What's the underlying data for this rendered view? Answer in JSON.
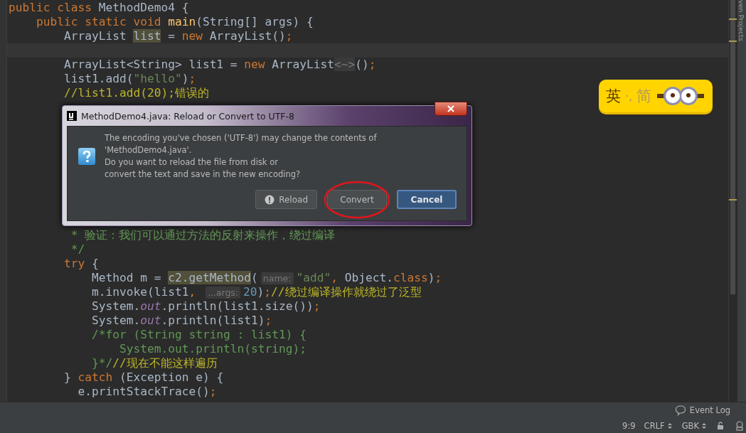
{
  "editor": {
    "lines_top": [
      {
        "current": false,
        "tokens": [
          {
            "kind": "keyword",
            "text": "public class "
          },
          {
            "kind": "plain",
            "text": "MethodDemo4 {"
          }
        ]
      },
      {
        "current": false,
        "tokens": [
          {
            "kind": "keyword",
            "text": "    public static void "
          },
          {
            "kind": "method",
            "text": "main"
          },
          {
            "kind": "plain",
            "text": "(String[] args) {"
          }
        ]
      },
      {
        "current": false,
        "tokens": [
          {
            "kind": "plain",
            "text": "        ArrayList "
          },
          {
            "kind": "usage",
            "text": "list"
          },
          {
            "kind": "plain",
            "text": " = "
          },
          {
            "kind": "keyword",
            "text": "new "
          },
          {
            "kind": "plain",
            "text": "ArrayList()"
          },
          {
            "kind": "keyword",
            "text": ";"
          }
        ]
      },
      {
        "current": true
      },
      {
        "current": false,
        "tokens": [
          {
            "kind": "plain",
            "text": "        ArrayList<String> list1 = "
          },
          {
            "kind": "keyword",
            "text": "new "
          },
          {
            "kind": "plain",
            "text": "ArrayList"
          },
          {
            "kind": "folded",
            "text": "<~>"
          },
          {
            "kind": "plain",
            "text": "()"
          },
          {
            "kind": "keyword",
            "text": ";"
          }
        ]
      },
      {
        "current": false,
        "tokens": [
          {
            "kind": "plain",
            "text": "        list1.add("
          },
          {
            "kind": "string",
            "text": "\"hello\""
          },
          {
            "kind": "plain",
            "text": ")"
          },
          {
            "kind": "keyword",
            "text": ";"
          }
        ]
      },
      {
        "current": false,
        "tokens": [
          {
            "kind": "comment",
            "text": "        //list1.add(20);错误的"
          }
        ]
      }
    ],
    "lines_bottom": [
      {
        "current": false,
        "tokens": [
          {
            "kind": "doc",
            "text": "         * 验证：我们可以通过方法的反射来操作，绕过编译"
          }
        ]
      },
      {
        "current": false,
        "tokens": [
          {
            "kind": "doc",
            "text": "         */"
          }
        ]
      },
      {
        "current": false,
        "tokens": [
          {
            "kind": "keyword",
            "text": "        try "
          },
          {
            "kind": "plain",
            "text": "{"
          }
        ]
      },
      {
        "current": false,
        "tokens": [
          {
            "kind": "plain",
            "text": "            Method m = "
          },
          {
            "kind": "usage",
            "text": "c2.getMethod"
          },
          {
            "kind": "plain",
            "text": "("
          },
          {
            "kind": "hint",
            "text": "name:"
          },
          {
            "kind": "string",
            "text": "\"add\""
          },
          {
            "kind": "keyword",
            "text": ", "
          },
          {
            "kind": "plain",
            "text": "Object."
          },
          {
            "kind": "keyword",
            "text": "class"
          },
          {
            "kind": "plain",
            "text": ")"
          },
          {
            "kind": "keyword",
            "text": ";"
          }
        ]
      },
      {
        "current": false,
        "tokens": [
          {
            "kind": "plain",
            "text": "            m.invoke(list1"
          },
          {
            "kind": "keyword",
            "text": ", "
          },
          {
            "kind": "hint",
            "text": "...args:"
          },
          {
            "kind": "number",
            "text": "20"
          },
          {
            "kind": "plain",
            "text": ")"
          },
          {
            "kind": "keyword",
            "text": ";"
          },
          {
            "kind": "comment",
            "text": "//绕过编译操作就绕过了泛型"
          }
        ]
      },
      {
        "current": false,
        "tokens": [
          {
            "kind": "plain",
            "text": "            System."
          },
          {
            "kind": "field",
            "text": "out"
          },
          {
            "kind": "plain",
            "text": ".println(list1.size())"
          },
          {
            "kind": "keyword",
            "text": ";"
          }
        ]
      },
      {
        "current": false,
        "tokens": [
          {
            "kind": "plain",
            "text": "            System."
          },
          {
            "kind": "field",
            "text": "out"
          },
          {
            "kind": "plain",
            "text": ".println(list1)"
          },
          {
            "kind": "keyword",
            "text": ";"
          }
        ]
      },
      {
        "current": false,
        "tokens": [
          {
            "kind": "doc",
            "text": "            /*for (String string : list1) {"
          }
        ]
      },
      {
        "current": false,
        "tokens": [
          {
            "kind": "doc",
            "text": "                System.out.println(string);"
          }
        ]
      },
      {
        "current": false,
        "tokens": [
          {
            "kind": "doc",
            "text": "            }*/"
          },
          {
            "kind": "comment",
            "text": "//现在不能这样遍历"
          }
        ]
      },
      {
        "current": false,
        "tokens": [
          {
            "kind": "plain",
            "text": "        } "
          },
          {
            "kind": "keyword",
            "text": "catch "
          },
          {
            "kind": "plain",
            "text": "(Exception e) {"
          }
        ]
      },
      {
        "current": false,
        "tokens": [
          {
            "kind": "plain",
            "text": "          e.printStackTrace()"
          },
          {
            "kind": "keyword",
            "text": ";"
          }
        ]
      }
    ]
  },
  "ime_badge": {
    "mode": "英",
    "punctuation": "·,",
    "script": "简"
  },
  "tool_window_stripe": {
    "label": "ven Projects"
  },
  "dialog": {
    "title": "MethodDemo4.java: Reload or Convert to UTF-8",
    "message": [
      "The encoding you've chosen ('UTF-8') may change the contents of",
      "'MethodDemo4.java'.",
      "Do you want to reload the file from disk or",
      "convert the text and save in the new encoding?"
    ],
    "buttons": [
      {
        "label": "Reload",
        "kind": "warning",
        "default": false,
        "circled": false
      },
      {
        "label": "Convert",
        "kind": "plain",
        "default": false,
        "circled": true
      },
      {
        "label": "Cancel",
        "kind": "plain",
        "default": true,
        "circled": false
      }
    ]
  },
  "status": {
    "event_log": "Event Log",
    "position": "9:9",
    "line_separator": "CRLF",
    "encoding": "GBK"
  }
}
